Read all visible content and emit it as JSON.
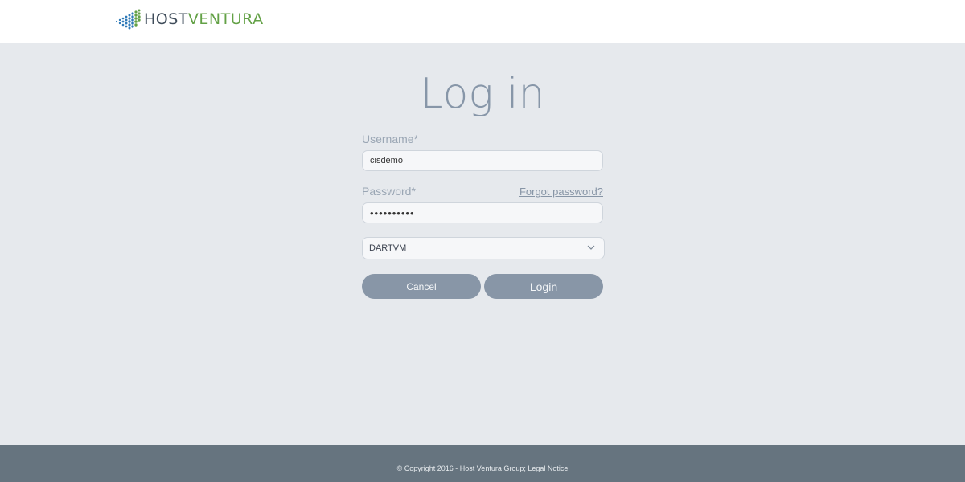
{
  "header": {
    "logo_host": "HOST",
    "logo_ventura": "VENTURA"
  },
  "colors": {
    "logo_dark": "#3f4c5a",
    "logo_green": "#63a146",
    "logo_dots": "#2f7ab8",
    "button_bg": "#8896a7",
    "footer_bg": "#66747f",
    "page_bg": "#e6e9ed"
  },
  "login": {
    "title": "Log in",
    "username_label": "Username*",
    "username_value": "cisdemo",
    "password_label": "Password*",
    "password_value": "••••••••••",
    "forgot_link": "Forgot password?",
    "domain_selected": "DARTVM",
    "cancel_label": "Cancel",
    "login_label": "Login"
  },
  "icons": {
    "logo": "hostventura-dots-logo",
    "select_arrow": "chevron-down-icon"
  },
  "footer": {
    "copyright": "© Copyright 2016 - Host Ventura Group; Legal Notice"
  }
}
